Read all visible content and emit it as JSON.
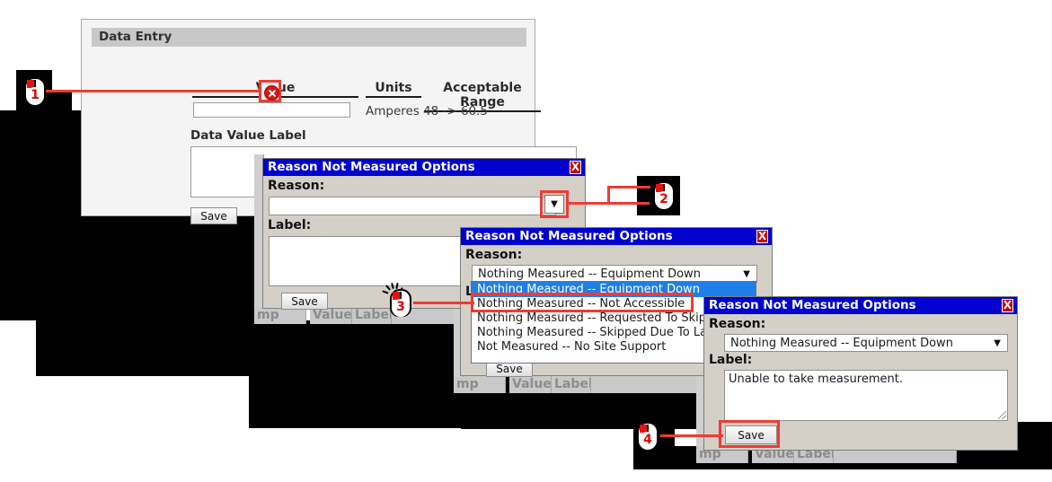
{
  "data_entry": {
    "title": "Data Entry",
    "columns": {
      "value": "Value",
      "units": "Units",
      "range": "Acceptable Range"
    },
    "value_input": "",
    "units_text": "Amperes",
    "range_text": "48 -> 60.5",
    "label_caption": "Data Value Label",
    "label_value": "",
    "save_label": "Save",
    "error_icon": "error-circle-x-icon"
  },
  "dialog2": {
    "title": "Reason Not Measured Options",
    "close_label": "X",
    "reason_caption": "Reason:",
    "reason_value": "",
    "label_caption": "Label:",
    "label_value": "",
    "save_label": "Save",
    "caret": "▼"
  },
  "dialog3": {
    "title": "Reason Not Measured Options",
    "close_label": "X",
    "reason_caption": "Reason:",
    "reason_value": "Nothing Measured -- Equipment Down",
    "label_caption": "Label:",
    "save_label": "Save",
    "caret": "▼",
    "options": [
      "Nothing Measured -- Equipment Down",
      "Nothing Measured -- Not Accessible",
      "Nothing Measured -- Requested To Skip",
      "Nothing Measured -- Skipped Due To Lack O",
      "Not Measured -- No Site Support"
    ],
    "selected_index": 0
  },
  "dialog4": {
    "title": "Reason Not Measured Options",
    "close_label": "X",
    "reason_caption": "Reason:",
    "reason_value": "Nothing Measured -- Equipment Down",
    "label_caption": "Label:",
    "label_value": "Unable to take measurement.",
    "save_label": "Save",
    "caret": "▼"
  },
  "background_tables": {
    "columns": [
      "mp",
      "Value",
      "Label"
    ]
  },
  "steps": [
    {
      "number": "1",
      "icon": "mouse-click-icon"
    },
    {
      "number": "2",
      "icon": "mouse-click-icon"
    },
    {
      "number": "3",
      "icon": "mouse-click-burst-icon"
    },
    {
      "number": "4",
      "icon": "mouse-click-icon"
    }
  ],
  "colors": {
    "highlight": "#ef3b33",
    "dialog_titlebar": "#0000cf",
    "selection": "#1f7fe8",
    "marker_number": "#e00000"
  }
}
